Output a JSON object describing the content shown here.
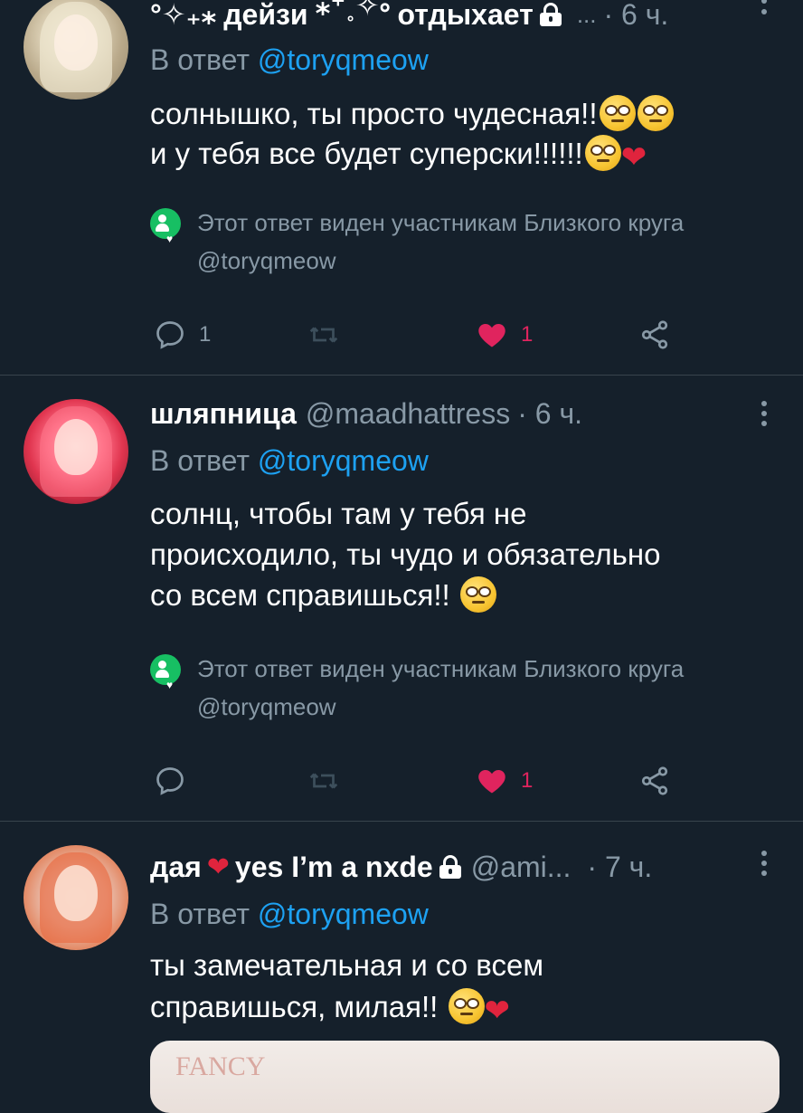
{
  "tweets": [
    {
      "name_prefix": "°✧₊⁎",
      "name": "дейзи",
      "name_suffix": "⁎⁺˳✧༚",
      "status": "отдыхает",
      "handle": "...",
      "time": "· 6 ч.",
      "reply_label": "В ответ",
      "reply_mention": "@toryqmeow",
      "text_line1": "солнышко, ты просто чудесная!!",
      "text_line2": "и у тебя все будет суперски!!!!!!",
      "circle_note_line1": "Этот ответ виден участникам Близкого круга",
      "circle_note_line2": "@toryqmeow",
      "reply_count": "1",
      "retweet_count": "",
      "like_count": "1"
    },
    {
      "name": "шляпница",
      "handle": "@maadhattress",
      "time": "· 6 ч.",
      "reply_label": "В ответ",
      "reply_mention": "@toryqmeow",
      "text_line1": "солнц, чтобы там у тебя не",
      "text_line2": "происходило, ты чудо и обязательно",
      "text_line3": "со всем справишься!!",
      "circle_note_line1": "Этот ответ виден участникам Близкого круга",
      "circle_note_line2": "@toryqmeow",
      "reply_count": "",
      "retweet_count": "",
      "like_count": "1"
    },
    {
      "name": "дая",
      "name_suffix": "yes I’m a nxde",
      "handle": "@ami...",
      "time": "· 7 ч.",
      "reply_label": "В ответ",
      "reply_mention": "@toryqmeow",
      "text_line1": "ты замечательная и со всем",
      "text_line2": "справишься, милая!!",
      "media_text": "FANCY"
    }
  ],
  "icons": {
    "reply": "reply-icon",
    "retweet": "retweet-icon",
    "like": "heart-filled-icon",
    "share": "share-icon",
    "more": "more-vertical-icon",
    "lock": "lock-icon",
    "close_circle": "close-circle-icon"
  },
  "colors": {
    "background": "#15202b",
    "muted": "#8899a6",
    "accent": "#1da1f2",
    "like": "#e0245e",
    "close_circle": "#17bf63"
  }
}
